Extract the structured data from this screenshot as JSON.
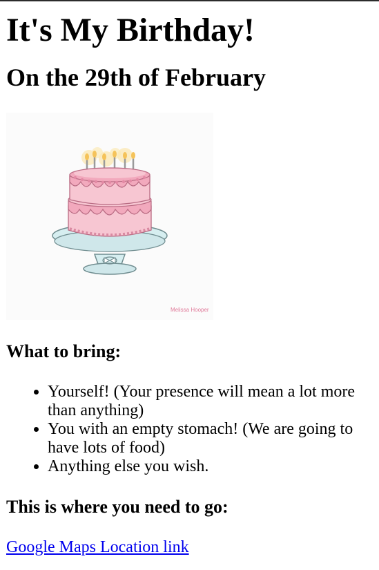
{
  "title": "It's My Birthday!",
  "subtitle": "On the 29th of February",
  "image": {
    "signature": "Melissa Hooper",
    "colors": {
      "frosting": "#f2a9bd",
      "cake": "#f7c6d2",
      "plate": "#cfe7ea",
      "flame": "#f5c35a"
    }
  },
  "bring": {
    "heading": "What to bring:",
    "items": [
      "Yourself! (Your presence will mean a lot more than anything)",
      "You with an empty stomach! (We are going to have lots of food)",
      "Anything else you wish."
    ]
  },
  "location": {
    "heading": "This is where you need to go:",
    "link_text": "Google Maps Location link"
  }
}
